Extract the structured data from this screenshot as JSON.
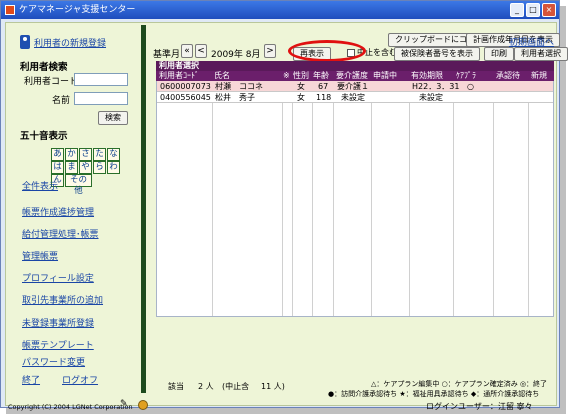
{
  "window": {
    "title": "ケアマネージャ支援センター",
    "controls": [
      "_",
      "□",
      "×"
    ]
  },
  "sidebar": {
    "register_link": "利用者の新規登録",
    "search_heading": "利用者検索",
    "code_label": "利用者コード",
    "name_label": "名前",
    "search_button": "検索",
    "kana_heading": "五十音表示",
    "kana": [
      [
        "あ",
        "か",
        "さ",
        "た",
        "な"
      ],
      [
        "は",
        "ま",
        "や",
        "ら",
        "わ"
      ]
    ],
    "kana_n": "ん",
    "kana_other": "その他",
    "show_all": "全件表示",
    "links": [
      "帳票作成進捗管理",
      "給付管理処理･帳票",
      "管理帳票",
      "プロフィール設定",
      "取引先事業所の追加",
      "未登録事業所登録",
      "帳票テンプレート",
      "パスワード変更"
    ],
    "end_link": "終了",
    "logoff_link": "ログオフ"
  },
  "toolbar": {
    "month_label": "基準月",
    "first": "«",
    "prev": "<",
    "year_month": "2009年 8月",
    "next": ">",
    "clipboard": "クリップボードにコピー",
    "plan_date": "計画作成年月日を表示",
    "initial_screen": "初期画面へ",
    "redisplay": "再表示",
    "include_stopped": "中止を含む",
    "insured_number": "被保険者番号を表示",
    "print": "印刷",
    "user_select_btn": "利用者選択"
  },
  "grid": {
    "title": "利用者選択",
    "columns": [
      "利用者ｺｰﾄﾞ",
      "氏名",
      "※",
      "性別",
      "年齢",
      "要介護度",
      "申請中",
      "有効期限",
      "ｹｱﾌﾟﾗ",
      "承認待",
      "新規"
    ],
    "rows": [
      {
        "code": "0600007073",
        "name": "村瀬　ココネ",
        "sex": "女",
        "age": "67",
        "care": "要介護１",
        "pending": "",
        "expiry": "H22．3．31",
        "plan": "○",
        "approval": "",
        "new": ""
      },
      {
        "code": "0400556045",
        "name": "松井　秀子",
        "sex": "女",
        "age": "118",
        "care": "未設定",
        "pending": "",
        "expiry": "未設定",
        "plan": "",
        "approval": "",
        "new": ""
      }
    ]
  },
  "footer": {
    "count_label": "該当",
    "count": "2 人",
    "stopped": "(中止含",
    "stopped_count": "11 人)",
    "legend_1": "△：ケアプラン編集中 ○：ケアプラン確定済み ◎：終了",
    "legend_2": "●：訪問介護承認待ち ★：福祉用具承認待ち ◆：通所介護承認待ち",
    "copyright": "Copyright (C) 2004 LGNet Corporation",
    "login_label": "ログインユーザー：",
    "login_user": "江留 寧々"
  }
}
